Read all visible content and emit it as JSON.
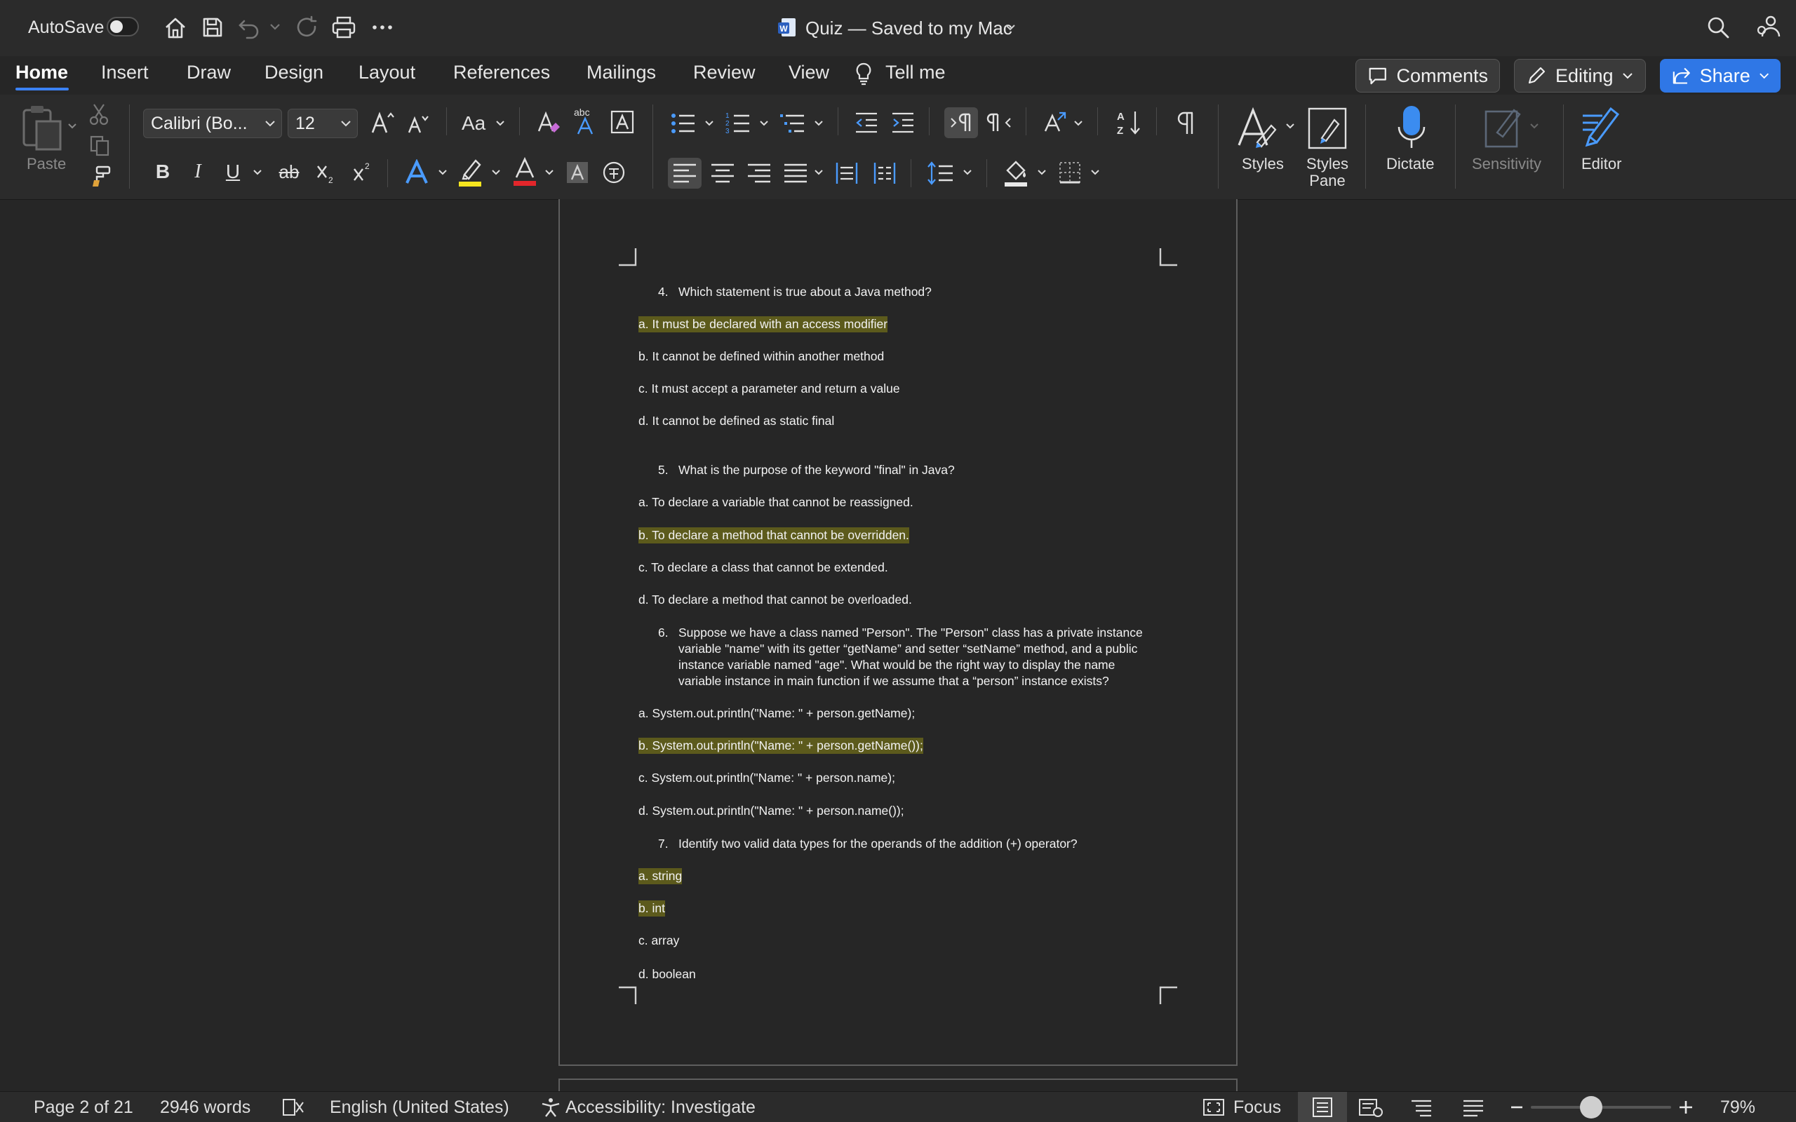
{
  "titlebar": {
    "autosave_label": "AutoSave",
    "doc_title": "Quiz — Saved to my Mac",
    "app_icon": "word-document-icon"
  },
  "tabs": [
    "Home",
    "Insert",
    "Draw",
    "Design",
    "Layout",
    "References",
    "Mailings",
    "Review",
    "View"
  ],
  "tell_me": "Tell me",
  "actions": {
    "comments": "Comments",
    "editing": "Editing",
    "share": "Share"
  },
  "ribbon": {
    "paste": "Paste",
    "font_name": "Calibri (Bo...",
    "font_size": "12",
    "styles": "Styles",
    "styles_pane_1": "Styles",
    "styles_pane_2": "Pane",
    "dictate": "Dictate",
    "sensitivity": "Sensitivity",
    "editor": "Editor",
    "bold": "B",
    "italic": "I",
    "underline": "U",
    "strike": "ab",
    "change_case": "Aa",
    "colors": {
      "highlight": "#f5e51f",
      "font_color": "#e3262b",
      "accent": "#3b82f6"
    }
  },
  "document": {
    "q4": {
      "num": "4.",
      "text": "Which statement is true about a Java method?"
    },
    "q4_options": [
      {
        "text": "a.  It must be declared with an access modifier",
        "highlighted": true
      },
      {
        "text": "b. It cannot be defined within another method",
        "highlighted": false
      },
      {
        "text": "c.  It must accept a parameter and return a value",
        "highlighted": false
      },
      {
        "text": "d. It cannot be defined as static final",
        "highlighted": false
      }
    ],
    "q5": {
      "num": "5.",
      "text": "What is the purpose of the keyword \"final\" in Java?"
    },
    "q5_options": [
      {
        "text": "a. To declare a variable that cannot be reassigned.",
        "highlighted": false
      },
      {
        "text": "b. To declare a method that cannot be overridden.",
        "highlighted": true
      },
      {
        "text": "c. To declare a class that cannot be extended.",
        "highlighted": false
      },
      {
        "text": "d. To declare a method that cannot be overloaded.",
        "highlighted": false
      }
    ],
    "q6": {
      "num": "6.",
      "lines": [
        "Suppose we have a class named \"Person\". The \"Person\" class has a private instance",
        "variable \"name\" with its getter “getName” and setter “setName” method, and a public",
        "instance variable named \"age\".  What would be the right way to display the name",
        "variable instance in main function if we assume that a “person” instance exists?"
      ]
    },
    "q6_options": [
      {
        "text": "a. System.out.println(\"Name: \" + person.getName);",
        "highlighted": false
      },
      {
        "text": "b. System.out.println(\"Name: \" + person.getName());",
        "highlighted": true
      },
      {
        "text": "c. System.out.println(\"Name: \" + person.name);",
        "highlighted": false
      },
      {
        "text": "d. System.out.println(\"Name: \" + person.name());",
        "highlighted": false
      }
    ],
    "q7": {
      "num": "7.",
      "text": "Identify two valid data types for the operands of the addition (+) operator?"
    },
    "q7_options": [
      {
        "text": "a. string",
        "highlighted": true
      },
      {
        "text": "b. int",
        "highlighted": true
      },
      {
        "text": "c. array",
        "highlighted": false
      },
      {
        "text": "d. boolean",
        "highlighted": false
      }
    ]
  },
  "statusbar": {
    "page": "Page 2 of 21",
    "words": "2946 words",
    "language": "English (United States)",
    "accessibility": "Accessibility: Investigate",
    "focus": "Focus",
    "zoom": "79%",
    "zoom_level_fraction": 0.43
  }
}
